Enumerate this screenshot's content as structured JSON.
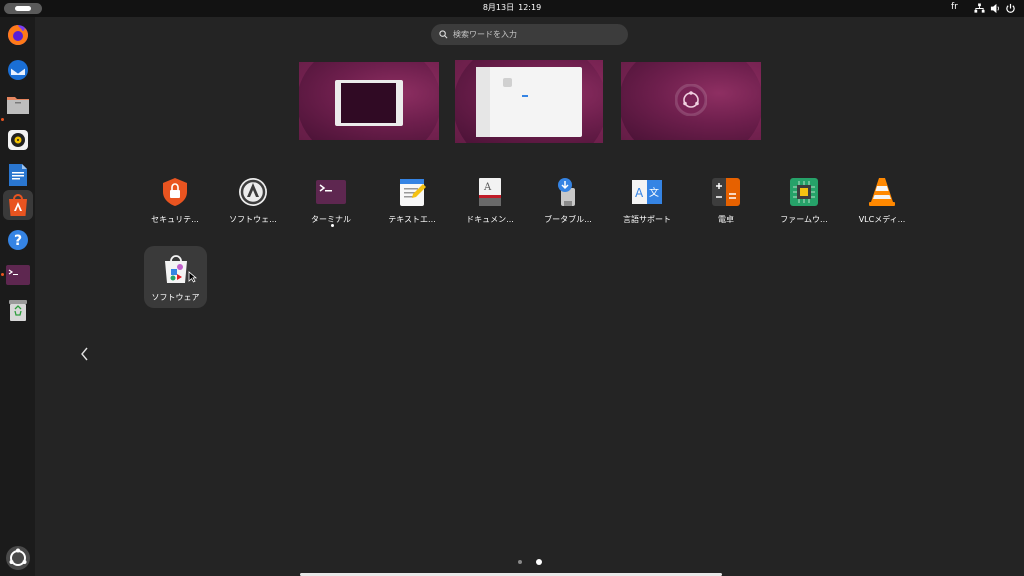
{
  "topbar": {
    "date": "8月13日",
    "time": "12:19",
    "input_source": "fr"
  },
  "search": {
    "placeholder": "検索ワードを入力"
  },
  "dock": {
    "items": [
      {
        "name": "Firefox",
        "icon": "firefox-icon"
      },
      {
        "name": "Thunderbird",
        "icon": "thunderbird-icon"
      },
      {
        "name": "ファイル",
        "icon": "files-icon"
      },
      {
        "name": "Rhythmbox",
        "icon": "rhythmbox-icon"
      },
      {
        "name": "LibreOffice Writer",
        "icon": "writer-icon"
      },
      {
        "name": "App Center",
        "icon": "app-center-icon"
      },
      {
        "name": "ヘルプ",
        "icon": "help-icon"
      },
      {
        "name": "ターミナル",
        "icon": "terminal-icon"
      },
      {
        "name": "ゴミ箱",
        "icon": "trash-icon"
      },
      {
        "name": "アプリケーションを表示する",
        "icon": "show-apps-icon"
      }
    ]
  },
  "apps": [
    {
      "label": "セキュリテ...",
      "icon": "security-icon"
    },
    {
      "label": "ソフトウェ...",
      "icon": "software-updater-icon"
    },
    {
      "label": "ターミナル",
      "icon": "terminal-icon"
    },
    {
      "label": "テキストエ...",
      "icon": "text-editor-icon"
    },
    {
      "label": "ドキュメン...",
      "icon": "document-viewer-icon"
    },
    {
      "label": "ブータブル...",
      "icon": "bootable-usb-icon"
    },
    {
      "label": "言語サポート",
      "icon": "language-support-icon"
    },
    {
      "label": "電卓",
      "icon": "calculator-icon"
    },
    {
      "label": "ファームウ...",
      "icon": "firmware-icon"
    },
    {
      "label": "VLCメディ...",
      "icon": "vlc-icon"
    }
  ],
  "folder": {
    "label": "ソフトウェア",
    "icon": "software-folder-icon"
  },
  "pagination": {
    "pages": 2,
    "current": 2
  },
  "colors": {
    "accent": "#e95420",
    "background": "#242424",
    "topbar": "#121212"
  }
}
